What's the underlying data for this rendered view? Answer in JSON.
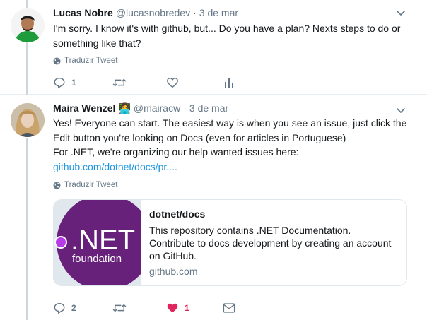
{
  "tweets": [
    {
      "name": "Lucas Nobre",
      "handle": "@lucasnobredev",
      "separator": "·",
      "date": "3 de mar",
      "text": "I'm sorry. I know it's with github, but... Do you have a plan? Nexts steps to do or something like that?",
      "translate_label": "Traduzir Tweet",
      "reply_count": "1",
      "retweet_count": "",
      "like_count": "",
      "icons": [
        "reply-icon",
        "retweet-icon",
        "like-icon",
        "analytics-icon"
      ]
    },
    {
      "name": "Maira Wenzel",
      "name_emoji": "👩‍💻",
      "handle": "@mairacw",
      "separator": "·",
      "date": "3 de mar",
      "text_line1": "Yes! Everyone can start. The easiest way is when you see an issue, just click the Edit button you're looking on Docs (even for articles in Portuguese)",
      "text_line2": "For .NET, we're organizing our help wanted issues here:",
      "link": "github.com/dotnet/docs/pr....",
      "translate_label": "Traduzir Tweet",
      "card": {
        "logo_text_big": ".NET",
        "logo_text_small": "foundation",
        "title": "dotnet/docs",
        "description": "This repository contains .NET Documentation. Contribute to docs development by creating an account on GitHub.",
        "domain": "github.com",
        "logo_colors": {
          "circle": "#68217a",
          "dot": "#b83be8"
        }
      },
      "reply_count": "2",
      "retweet_count": "",
      "like_count": "1",
      "like_color": "#e0245e",
      "icons": [
        "reply-icon",
        "retweet-icon",
        "like-filled-icon",
        "message-icon"
      ]
    }
  ]
}
